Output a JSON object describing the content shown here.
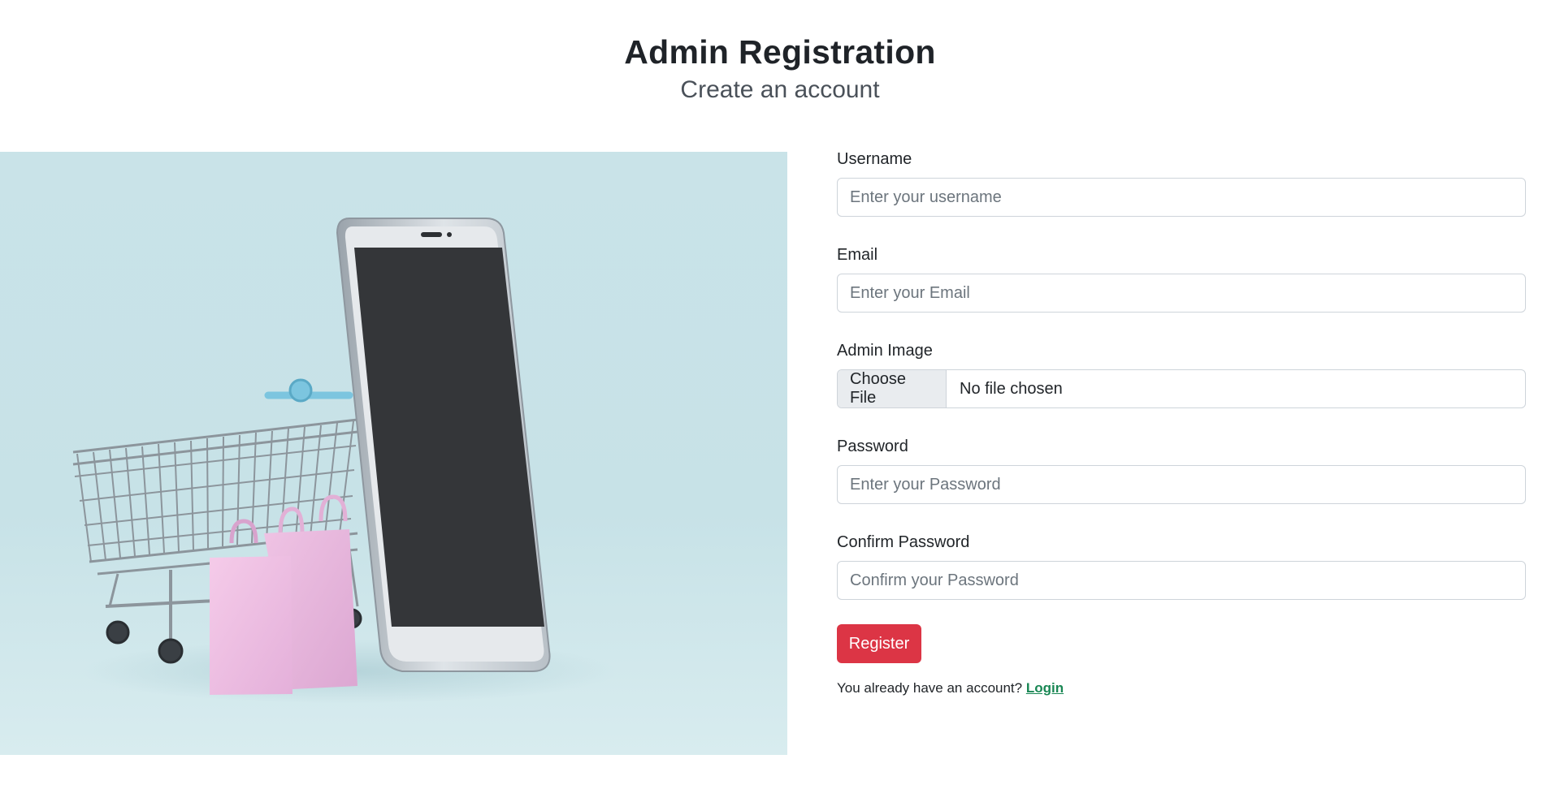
{
  "header": {
    "title": "Admin Registration",
    "subtitle": "Create an account"
  },
  "form": {
    "username": {
      "label": "Username",
      "placeholder": "Enter your username",
      "value": ""
    },
    "email": {
      "label": "Email",
      "placeholder": "Enter your Email",
      "value": ""
    },
    "admin_image": {
      "label": "Admin Image",
      "button_label": "Choose File",
      "status_text": "No file chosen"
    },
    "password": {
      "label": "Password",
      "placeholder": "Enter your Password",
      "value": ""
    },
    "confirm_password": {
      "label": "Confirm Password",
      "placeholder": "Confirm your Password",
      "value": ""
    },
    "submit_label": "Register",
    "login_prompt": "You already have an account?",
    "login_link": "Login"
  },
  "colors": {
    "primary_button": "#dc3545",
    "link": "#198754",
    "hero_background": "#c9e3e8"
  }
}
